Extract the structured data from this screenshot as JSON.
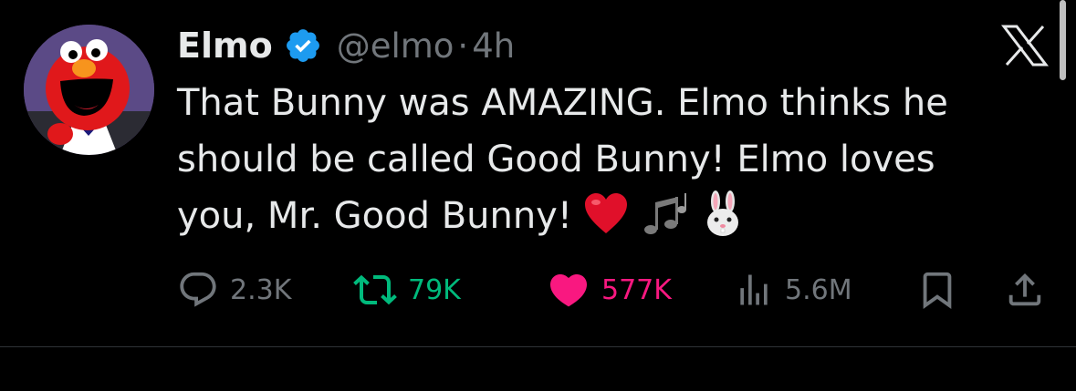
{
  "tweet": {
    "author": {
      "name": "Elmo",
      "handle": "@elmo",
      "verified": true,
      "verified_badge_color": "#1d9bf0"
    },
    "separator": "·",
    "time": "4h",
    "text_lines": [
      "That Bunny was AMAZING. Elmo thinks he",
      "should be called Good Bunny! Elmo loves",
      "you, Mr. Good Bunny!"
    ],
    "emojis": [
      "red-heart",
      "musical-notes",
      "rabbit-face"
    ],
    "actions": {
      "replies": "2.3K",
      "retweets": "79K",
      "likes": "577K",
      "views": "5.6M"
    },
    "liked": true,
    "colors": {
      "retweet": "#00ba7c",
      "like": "#f91880",
      "muted": "#71767b",
      "text": "#e7e9ea",
      "background": "#000000"
    }
  },
  "app": {
    "logo": "x-logo"
  },
  "icons": {
    "reply": "reply-icon",
    "retweet": "retweet-icon",
    "like": "heart-icon",
    "views": "views-icon",
    "bookmark": "bookmark-icon",
    "share": "share-icon"
  }
}
